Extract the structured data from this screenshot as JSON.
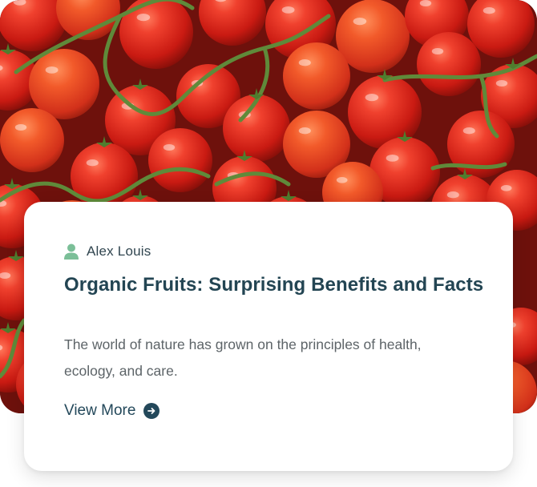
{
  "post": {
    "image_alt": "Bunches of red tomatoes on the vine",
    "author": "Alex Louis",
    "title": "Organic Fruits: Surprising Benefits and Facts",
    "excerpt": "The world of nature has grown on the principles of health, ecology, and care.",
    "link_label": "View More"
  },
  "icons": {
    "author": "user-icon",
    "link": "arrow-right-circle-icon"
  },
  "colors": {
    "title": "#234553",
    "author_icon": "#7bbf98",
    "link": "#23485a",
    "tomato": "#d8261c"
  }
}
